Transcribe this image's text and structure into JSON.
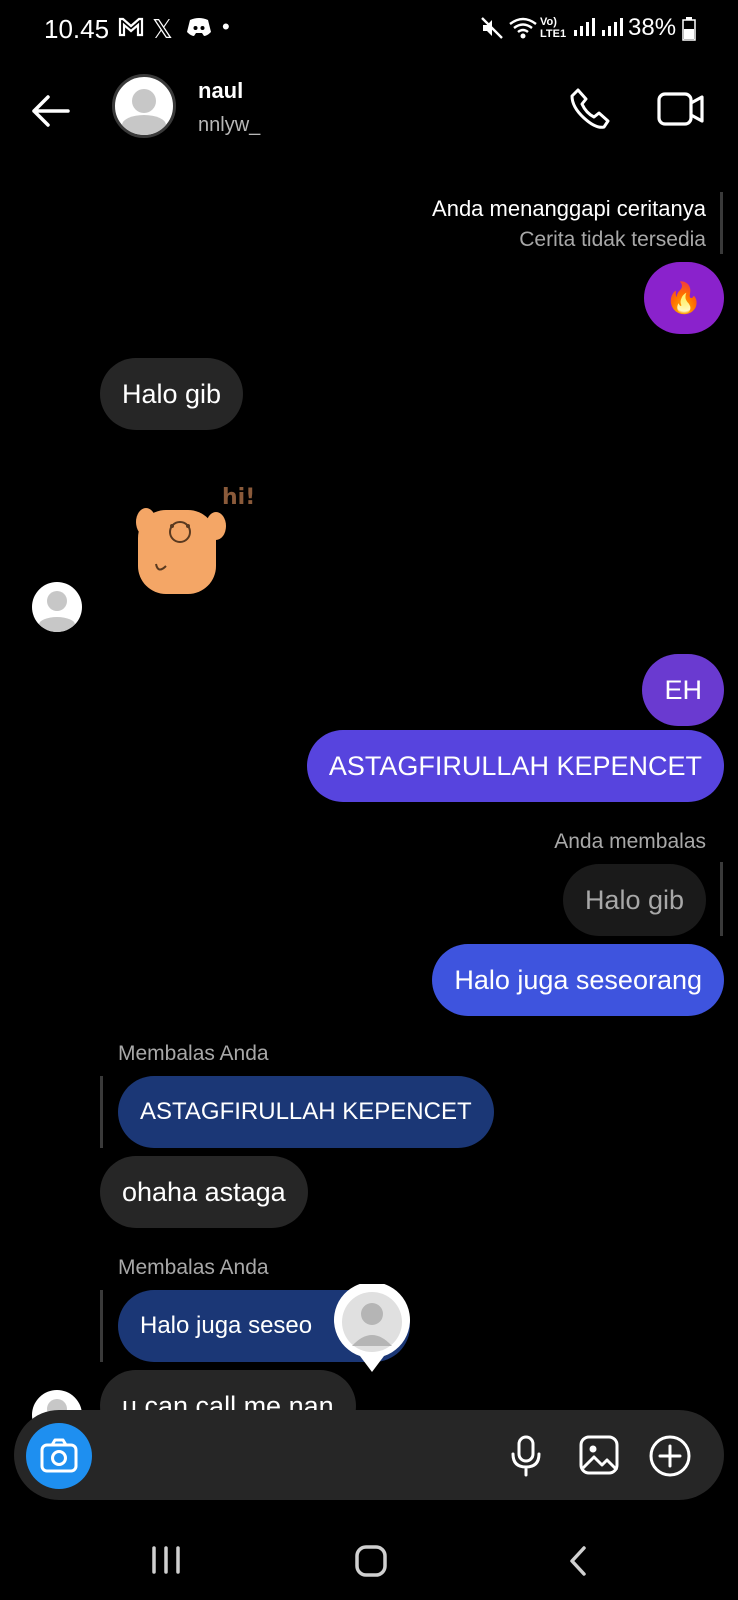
{
  "status_bar": {
    "time": "10.45",
    "battery": "38%",
    "icons": [
      "gmail-icon",
      "x-icon",
      "discord-icon",
      "dot-icon",
      "mute-icon",
      "wifi-icon",
      "volte-icon",
      "signal-icon",
      "signal-icon",
      "battery-icon"
    ]
  },
  "header": {
    "name": "naul",
    "username": "nnlyw_"
  },
  "messages": {
    "story_reply_label": "Anda menanggapi ceritanya",
    "story_unavailable": "Cerita tidak tersedia",
    "story_reaction": "🔥",
    "m1": "Halo gib",
    "sticker_text": "hi!",
    "m2": "EH",
    "m3": "ASTAGFIRULLAH KEPENCET",
    "you_replied_label": "Anda membalas",
    "m4_quoted": "Halo gib",
    "m4": "Halo juga seseorang",
    "reply_label_1": "Membalas Anda",
    "m5_quoted": "ASTAGFIRULLAH KEPENCET",
    "m5": "ohaha astaga",
    "reply_label_2": "Membalas Anda",
    "m6_quoted": "Halo juga seseo",
    "m6": "u can call me nan"
  },
  "colors": {
    "background": "#000000",
    "received_bubble": "#262626",
    "sent_purple": "#6a3ad0",
    "sent_indigo": "#5744de",
    "sent_blue": "#3e54de",
    "quote_bubble": "#1b3776",
    "camera_button": "#1e8ff0"
  }
}
